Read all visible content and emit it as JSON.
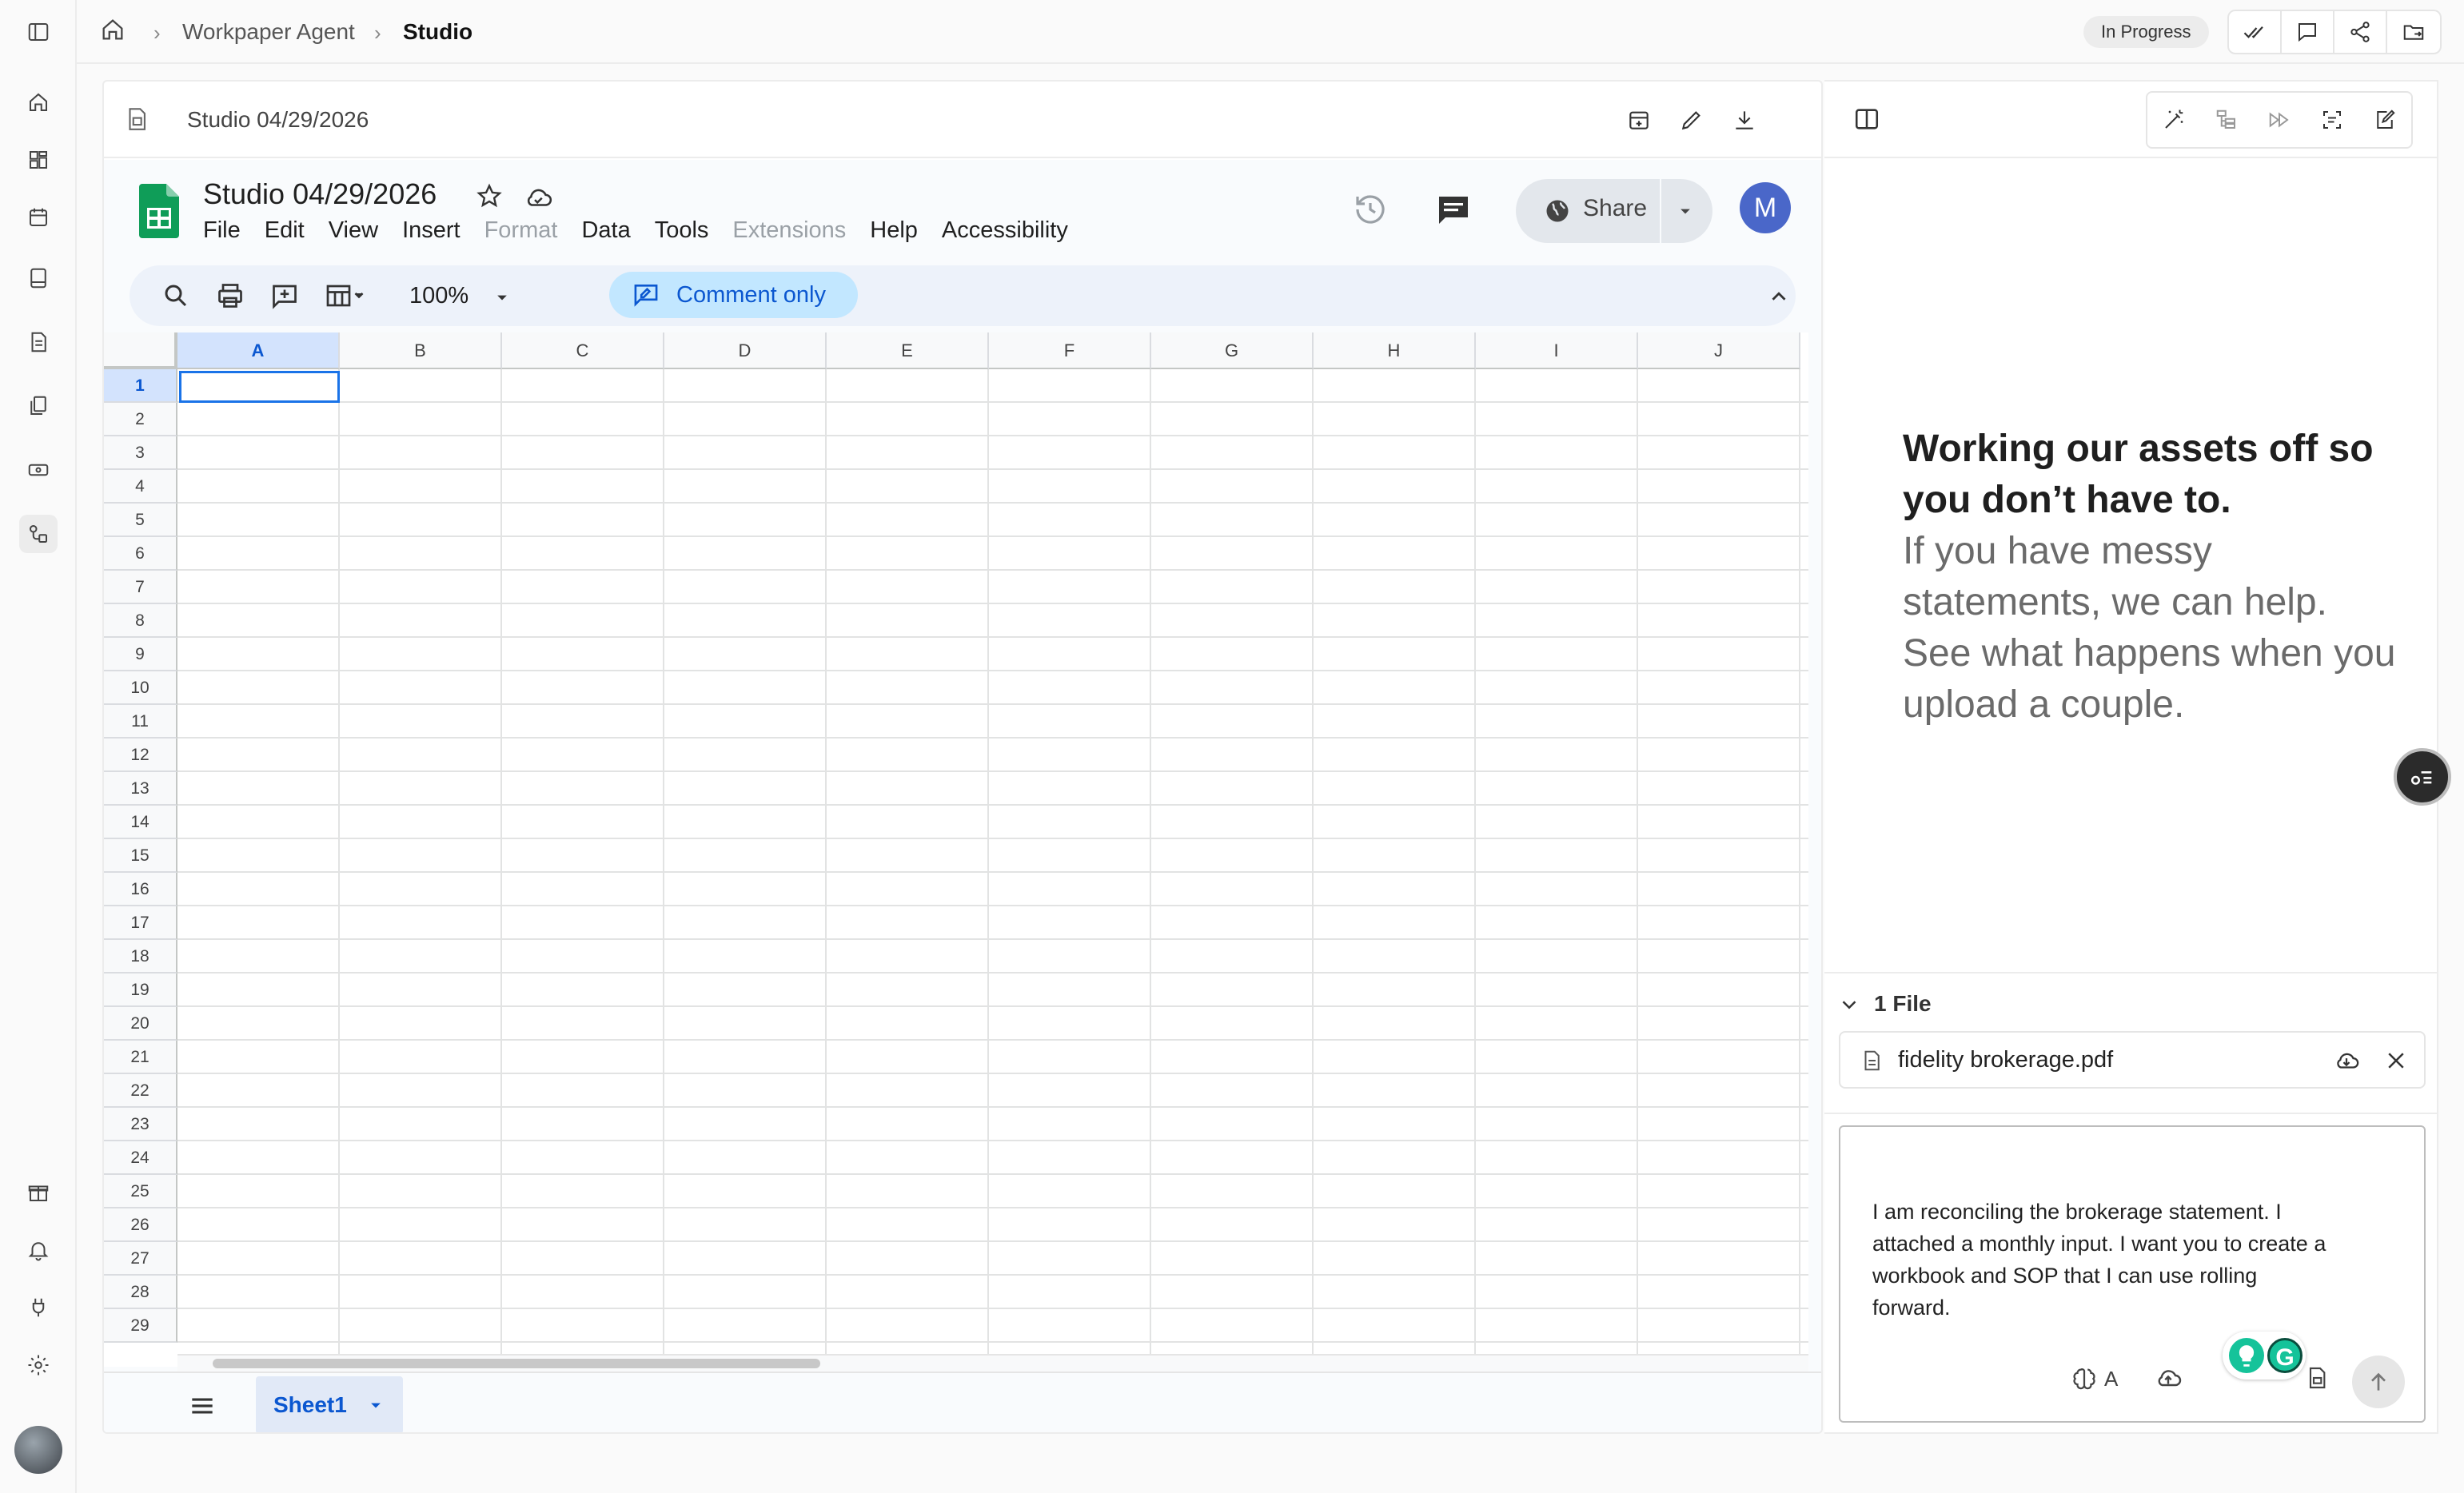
{
  "breadcrumb": {
    "items": [
      "Workpaper Agent",
      "Studio"
    ]
  },
  "status": {
    "label": "In Progress"
  },
  "document": {
    "title": "Studio 04/29/2026"
  },
  "sheets": {
    "name": "Studio 04/29/2026",
    "menu": [
      "File",
      "Edit",
      "View",
      "Insert",
      "Format",
      "Data",
      "Tools",
      "Extensions",
      "Help",
      "Accessibility"
    ],
    "disabled_menu": [
      "Format",
      "Extensions"
    ],
    "zoom": "100%",
    "mode": "Comment only",
    "share_label": "Share",
    "avatar_initial": "M",
    "columns": [
      "A",
      "B",
      "C",
      "D",
      "E",
      "F",
      "G",
      "H",
      "I",
      "J"
    ],
    "rows": [
      "1",
      "2",
      "3",
      "4",
      "5",
      "6",
      "7",
      "8",
      "9",
      "10",
      "11",
      "12",
      "13",
      "14",
      "15",
      "16",
      "17",
      "18",
      "19",
      "20",
      "21",
      "22",
      "23",
      "24",
      "25",
      "26",
      "27",
      "28",
      "29"
    ],
    "selected_cell": "A1",
    "tab": "Sheet1",
    "colors": {
      "brand_green": "#0f9d58",
      "accent_blue": "#0b57d0",
      "selection_bg": "#d3e3fd"
    }
  },
  "panel": {
    "hero_strong": "Working our assets off so you don’t have to.",
    "hero_sub": "If you have messy statements, we can help. See what happens when you upload a couple.",
    "files_header": "1 File",
    "file_name": "fidelity brokerage.pdf",
    "composer_text": "I am reconciling the brokerage statement. I attached a monthly input. I want you to create a workbook and SOP that I can use rolling forward.",
    "model_label": "A"
  }
}
